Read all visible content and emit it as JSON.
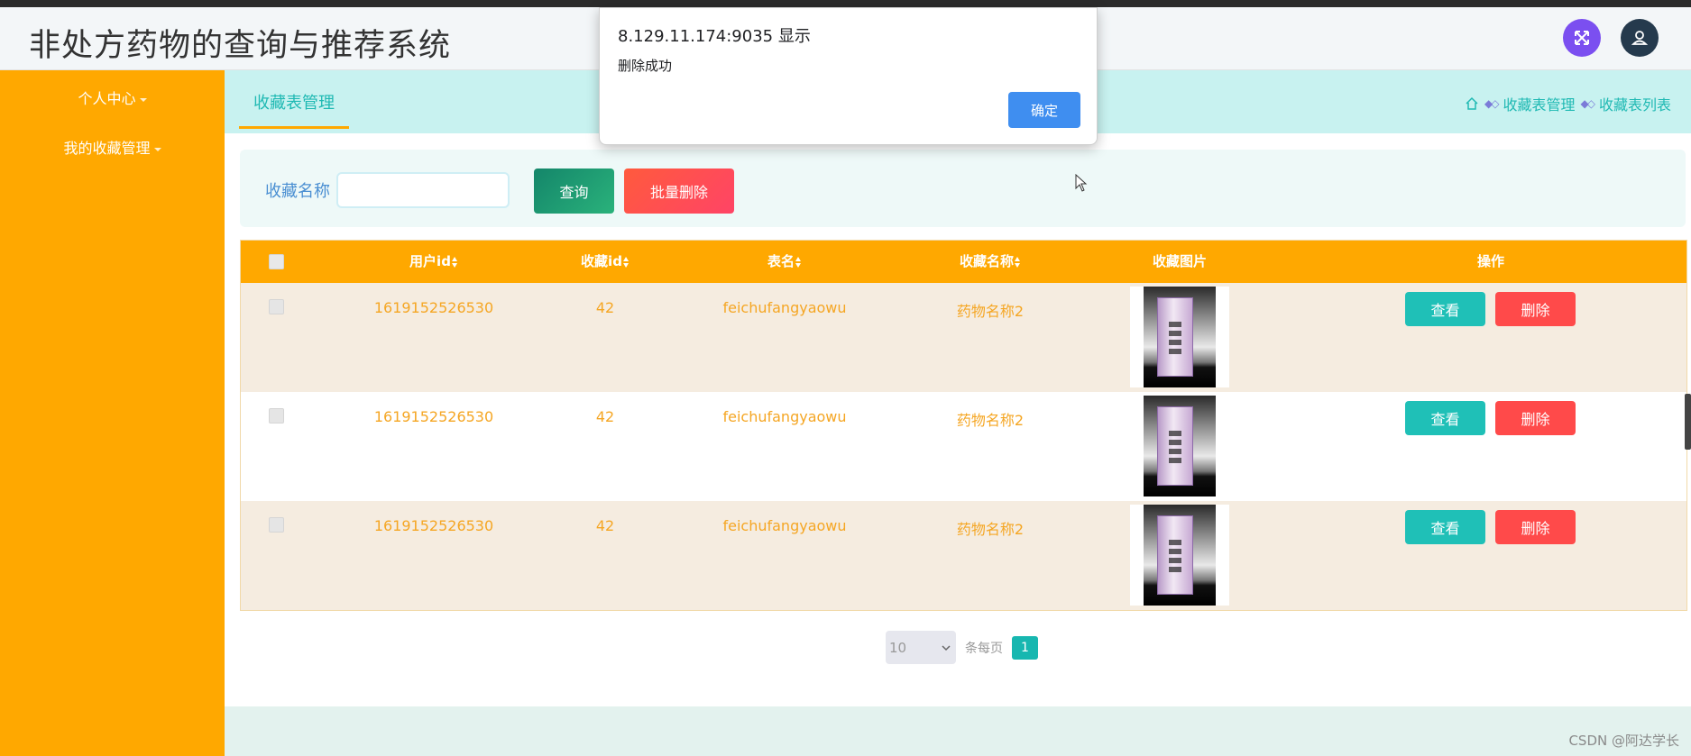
{
  "header": {
    "title": "非处方药物的查询与推荐系统"
  },
  "sidebar": {
    "items": [
      {
        "label": "个人中心"
      },
      {
        "label": "我的收藏管理"
      }
    ]
  },
  "tabbar": {
    "active_tab": "收藏表管理",
    "breadcrumb": [
      "收藏表管理",
      "收藏表列表"
    ]
  },
  "search": {
    "label": "收藏名称",
    "value": "",
    "placeholder": "",
    "query_button": "查询",
    "batch_delete_button": "批量删除"
  },
  "table": {
    "columns": [
      "用户id",
      "收藏id",
      "表名",
      "收藏名称",
      "收藏图片",
      "操作"
    ],
    "rows": [
      {
        "user_id": "1619152526530",
        "fav_id": "42",
        "table_name": "feichufangyaowu",
        "fav_name": "药物名称2",
        "view": "查看",
        "delete": "删除"
      },
      {
        "user_id": "1619152526530",
        "fav_id": "42",
        "table_name": "feichufangyaowu",
        "fav_name": "药物名称2",
        "view": "查看",
        "delete": "删除"
      },
      {
        "user_id": "1619152526530",
        "fav_id": "42",
        "table_name": "feichufangyaowu",
        "fav_name": "药物名称2",
        "view": "查看",
        "delete": "删除"
      }
    ]
  },
  "pagination": {
    "page_size": "10",
    "per_page_label": "条每页",
    "current_page": "1"
  },
  "dialog": {
    "title": "8.129.11.174:9035 显示",
    "message": "删除成功",
    "ok_button": "确定"
  },
  "watermark": "CSDN @阿达学长",
  "colors": {
    "sidebar": "#ffa800",
    "accent": "#1fb9b3",
    "danger": "#ff4a4a",
    "primary": "#3f8ef0"
  }
}
